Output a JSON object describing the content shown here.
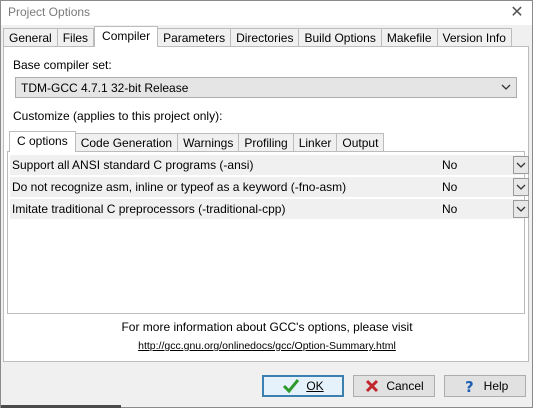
{
  "window": {
    "title": "Project Options"
  },
  "top_tabs": [
    "General",
    "Files",
    "Compiler",
    "Parameters",
    "Directories",
    "Build Options",
    "Makefile",
    "Version Info"
  ],
  "active_top_tab": "Compiler",
  "compiler": {
    "base_label": "Base compiler set:",
    "base_value": "TDM-GCC 4.7.1 32-bit Release",
    "customize_label": "Customize (applies to this project only):"
  },
  "inner_tabs": [
    "C options",
    "Code Generation",
    "Warnings",
    "Profiling",
    "Linker",
    "Output"
  ],
  "active_inner_tab": "C options",
  "options": [
    {
      "label": "Support all ANSI standard C programs (-ansi)",
      "value": "No"
    },
    {
      "label": "Do not recognize asm, inline or typeof as a keyword (-fno-asm)",
      "value": "No"
    },
    {
      "label": "Imitate traditional C preprocessors (-traditional-cpp)",
      "value": "No"
    }
  ],
  "info": {
    "text": "For more information about GCC's options, please visit",
    "link": "http://gcc.gnu.org/onlinedocs/gcc/Option-Summary.html"
  },
  "buttons": {
    "ok": "OK",
    "cancel": "Cancel",
    "help": "Help"
  },
  "colors": {
    "ok_check": "#2e9a2e",
    "cancel_x": "#c0262c",
    "help_q": "#1e5fb4"
  }
}
